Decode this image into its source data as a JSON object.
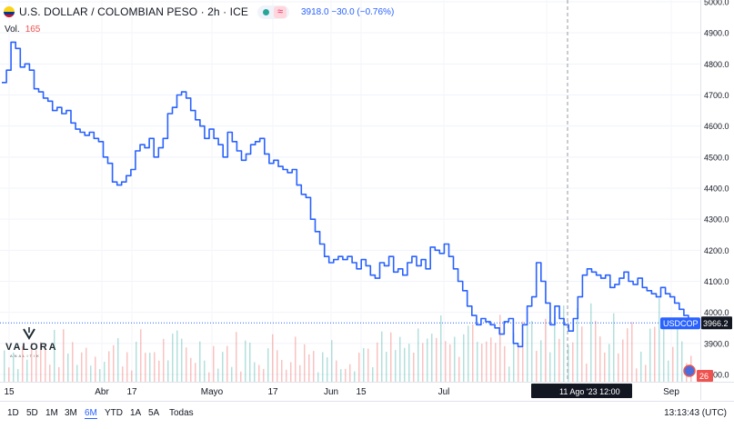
{
  "header": {
    "title": "U.S. DOLLAR / COLOMBIAN PESO · 2h · ICE",
    "quote": "3918.0 −30.0 (−0.76%)",
    "volume_label": "Vol.",
    "volume_value": "165"
  },
  "logo": {
    "name": "VALORA",
    "sub": "ANALITIK"
  },
  "price_label": {
    "symbol": "USDCOP",
    "value": "3966.2"
  },
  "crosshair": {
    "x_label": "11 Ago '23   12:00",
    "y_value": 3966.2
  },
  "badge": "26",
  "timeframes": [
    {
      "label": "1D",
      "active": false
    },
    {
      "label": "5D",
      "active": false
    },
    {
      "label": "1M",
      "active": false
    },
    {
      "label": "3M",
      "active": false
    },
    {
      "label": "6M",
      "active": true
    },
    {
      "label": "YTD",
      "active": false
    },
    {
      "label": "1A",
      "active": false
    },
    {
      "label": "5A",
      "active": false
    },
    {
      "label": "Todas",
      "active": false
    }
  ],
  "clock": "13:13:43 (UTC)",
  "colors": {
    "line": "#2962ff",
    "vol_up": "#26a69a",
    "vol_down": "#ef5350"
  },
  "chart_data": {
    "type": "line",
    "ylim": [
      3800,
      5000
    ],
    "yticks": [
      5000,
      4900,
      4800,
      4700,
      4600,
      4500,
      4400,
      4300,
      4200,
      4100,
      4000,
      3900,
      3800
    ],
    "xticks": [
      "15",
      "Abr",
      "17",
      "Mayo",
      "17",
      "Jun",
      "15",
      "Jul",
      "Ago",
      "Sep"
    ],
    "series": [
      {
        "values": [
          4740,
          4780,
          4870,
          4850,
          4790,
          4800,
          4780,
          4720,
          4710,
          4690,
          4680,
          4650,
          4660,
          4640,
          4650,
          4610,
          4590,
          4580,
          4570,
          4580,
          4560,
          4550,
          4500,
          4480,
          4420,
          4410,
          4420,
          4440,
          4460,
          4520,
          4540,
          4530,
          4560,
          4500,
          4530,
          4560,
          4640,
          4660,
          4700,
          4710,
          4690,
          4650,
          4620,
          4600,
          4560,
          4590,
          4560,
          4540,
          4500,
          4580,
          4550,
          4520,
          4490,
          4510,
          4540,
          4550,
          4560,
          4510,
          4480,
          4490,
          4470,
          4460,
          4450,
          4460,
          4410,
          4380,
          4370,
          4300,
          4260,
          4220,
          4180,
          4160,
          4170,
          4180,
          4170,
          4180,
          4160,
          4140,
          4170,
          4150,
          4120,
          4110,
          4160,
          4150,
          4180,
          4130,
          4140,
          4120,
          4160,
          4180,
          4150,
          4170,
          4140,
          4210,
          4200,
          4190,
          4220,
          4180,
          4140,
          4100,
          4070,
          4020,
          3990,
          3960,
          3980,
          3970,
          3960,
          3950,
          3930,
          3970,
          3980,
          3900,
          3890,
          3960,
          4020,
          4050,
          4160,
          4100,
          4030,
          3960,
          4020,
          3980,
          3960,
          3940,
          3980,
          4050,
          4120,
          4140,
          4130,
          4120,
          4110,
          4120,
          4080,
          4090,
          4110,
          4130,
          4100,
          4090,
          4110,
          4080,
          4070,
          4060,
          4050,
          4080,
          4060,
          4050,
          4030,
          4010,
          3990,
          3980,
          3966.2
        ]
      }
    ]
  }
}
